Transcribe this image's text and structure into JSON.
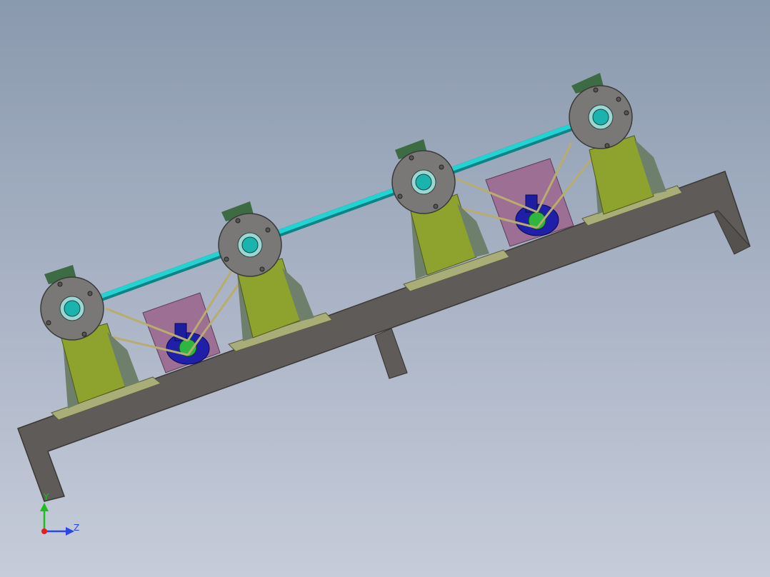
{
  "viewport": {
    "background_top": "#8a99ae",
    "background_bottom": "#c6ccd9"
  },
  "colors": {
    "frame": "#5f5b58",
    "frame_edge": "#3b3836",
    "support_body": "#8ea22e",
    "support_side": "#6e7f6c",
    "base_plate": "#a9ae78",
    "disc": "#7a7876",
    "disc_edge": "#3a3a3a",
    "shaft": "#21d4d2",
    "hub": "#1bb3ad",
    "funnel": "#3d6b44",
    "motor_box": "#9e6f95",
    "motor": "#1f1faa",
    "motor_pulley": "#2fb63f",
    "belt": "#b8ad6e",
    "axis_y": "#19c219",
    "axis_z": "#2a47e5",
    "axis_origin": "#e02020"
  },
  "triad": {
    "y_label": "Y",
    "z_label": "Z"
  }
}
